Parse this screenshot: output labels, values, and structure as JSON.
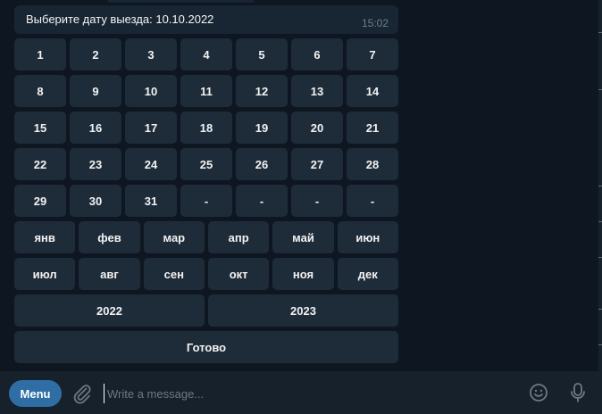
{
  "message": {
    "text": "Выберите дату выезда: 10.10.2022",
    "time": "15:02"
  },
  "keyboard": {
    "days": [
      [
        "1",
        "2",
        "3",
        "4",
        "5",
        "6",
        "7"
      ],
      [
        "8",
        "9",
        "10",
        "11",
        "12",
        "13",
        "14"
      ],
      [
        "15",
        "16",
        "17",
        "18",
        "19",
        "20",
        "21"
      ],
      [
        "22",
        "23",
        "24",
        "25",
        "26",
        "27",
        "28"
      ],
      [
        "29",
        "30",
        "31",
        "-",
        "-",
        "-",
        "-"
      ]
    ],
    "months": [
      [
        "янв",
        "фев",
        "мар",
        "апр",
        "май",
        "июн"
      ],
      [
        "июл",
        "авг",
        "сен",
        "окт",
        "ноя",
        "дек"
      ]
    ],
    "years": [
      "2022",
      "2023"
    ],
    "done": "Готово"
  },
  "input": {
    "menu_label": "Menu",
    "placeholder": "Write a message..."
  },
  "icons": {
    "attach": "paperclip-icon",
    "emoji": "smiley-icon",
    "voice": "microphone-icon"
  },
  "colors": {
    "background": "#0e1621",
    "bubble": "#182533",
    "key": "#1e2c3a",
    "menu_button": "#2f6ea5"
  }
}
